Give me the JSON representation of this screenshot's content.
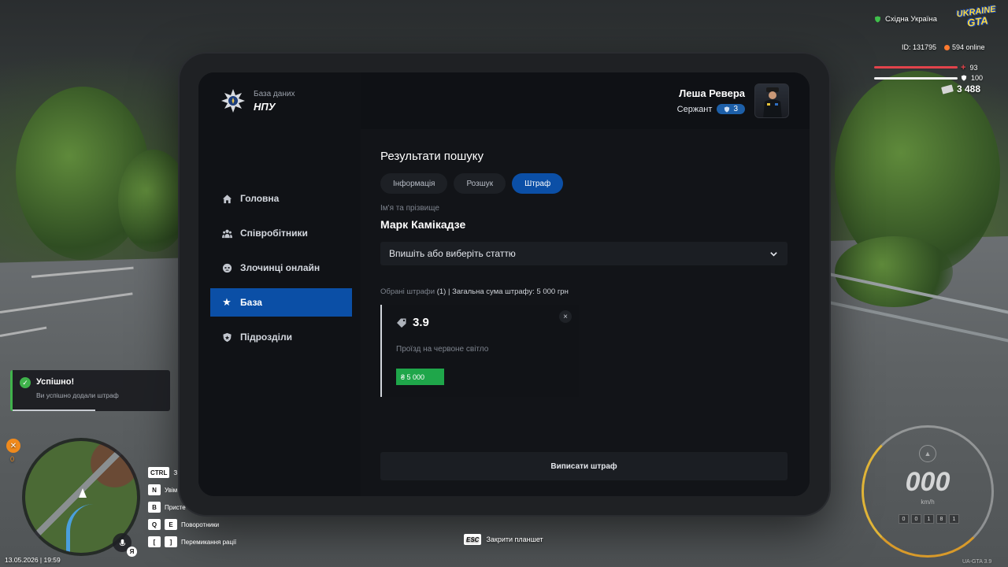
{
  "tablet": {
    "brand": {
      "subtitle": "База даних",
      "title": "НПУ"
    },
    "user": {
      "name": "Леша Ревера",
      "rank": "Сержант",
      "level": "3"
    },
    "nav": [
      {
        "label": "Головна",
        "icon": "home-icon"
      },
      {
        "label": "Співробітники",
        "icon": "users-icon"
      },
      {
        "label": "Злочинці онлайн",
        "icon": "mask-icon"
      },
      {
        "label": "База",
        "icon": "star-icon",
        "active": true
      },
      {
        "label": "Підрозділи",
        "icon": "shield-icon"
      }
    ],
    "content": {
      "title": "Результати пошуку",
      "tabs": [
        {
          "label": "Інформація",
          "active": false
        },
        {
          "label": "Розшук",
          "active": false
        },
        {
          "label": "Штраф",
          "active": true
        }
      ],
      "name_label": "Ім'я та прізвище",
      "person_name": "Марк Камікадзе",
      "article_select": "Впишіть або виберіть статтю",
      "summary": {
        "prefix": "Обрані штрафи",
        "count": "(1)",
        "rest": "| Загальна сума штрафу: 5 000 грн"
      },
      "fine": {
        "code": "3.9",
        "description": "Проїзд на червоне світло",
        "amount": "₴ 5 000",
        "remove": "×"
      },
      "submit_label": "Виписати штраф"
    }
  },
  "hud": {
    "region": "Східна Україна",
    "logo_line1": "UKRAINE",
    "logo_line2": "GTA",
    "id": "ID: 131795",
    "online": "594 online",
    "health": "93",
    "armor": "100",
    "money": "3 488",
    "toast": {
      "title": "Успішно!",
      "text": "Ви успішно додали штраф",
      "icon": "check-icon"
    },
    "map_badge": "0",
    "voice_key": "Я",
    "keys": [
      {
        "key": "CTRL",
        "label": "З"
      },
      {
        "key": "N",
        "label": "Увім"
      },
      {
        "key": "B",
        "label": "Присте"
      },
      {
        "keys": [
          "Q",
          "E"
        ],
        "label": "Поворотники"
      },
      {
        "keys": [
          "[",
          "]"
        ],
        "label": "Перемикання рації"
      }
    ],
    "datetime": "13.05.2026 | 19:59",
    "esc_key": "ESC",
    "esc_label": "Закрити планшет",
    "speed": "000",
    "speed_unit": "km/h",
    "odometer": [
      "0",
      "0",
      "1",
      "8",
      "1"
    ],
    "watermark": "UA-GTA 3.9"
  }
}
